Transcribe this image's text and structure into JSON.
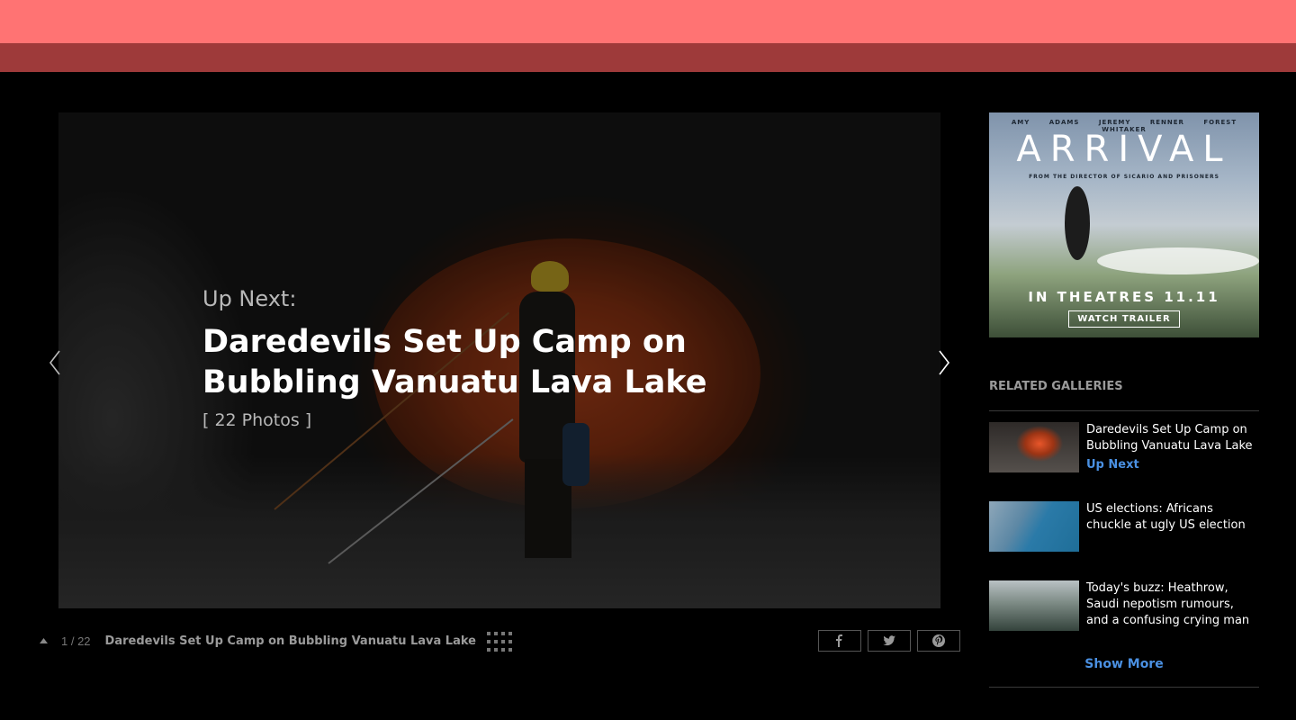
{
  "header": {
    "top_bar_color": "#ff7373",
    "sub_bar_color": "#9e3a3a"
  },
  "slide": {
    "up_next_label": "Up Next:",
    "title": "Daredevils Set Up Camp on Bubbling Vanuatu Lava Lake",
    "photo_count": "[ 22 Photos ]"
  },
  "navigation": {
    "prev_icon": "chevron-left-icon",
    "next_icon": "chevron-right-icon"
  },
  "caption": {
    "counter": "1 / 22",
    "title": "Daredevils Set Up Camp on Bubbling Vanuatu Lava Lake"
  },
  "share": {
    "icons": [
      "facebook-icon",
      "twitter-icon",
      "pinterest-icon"
    ]
  },
  "ad": {
    "cast": "AMY ADAMS JEREMY RENNER FOREST WHITAKER",
    "brand": "ARRIVAL",
    "tagline": "FROM THE DIRECTOR OF SICARIO AND PRISONERS",
    "release": "IN THEATRES 11.11",
    "cta": "WATCH TRAILER"
  },
  "related": {
    "heading": "RELATED GALLERIES",
    "items": [
      {
        "title": "Daredevils Set Up Camp on Bubbling Vanuatu Lava Lake",
        "badge": "Up Next"
      },
      {
        "title": "US elections: Africans chuckle at ugly US election"
      },
      {
        "title": "Today's buzz: Heathrow, Saudi nepotism rumours, and a confusing crying man"
      }
    ],
    "show_more": "Show More"
  },
  "colors": {
    "accent": "#4a90e2",
    "background": "#000000"
  }
}
